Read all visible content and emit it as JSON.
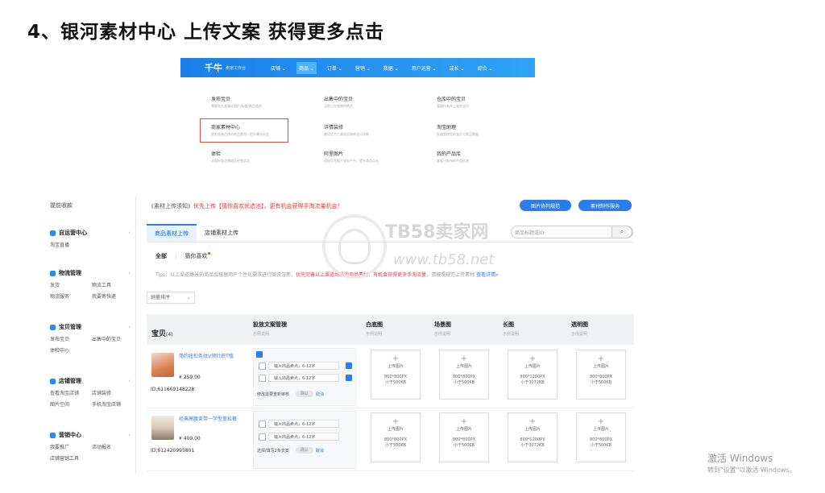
{
  "slide_title": "4、银河素材中心 上传文案 获得更多点击",
  "topnav": {
    "logo": "千牛",
    "logo_sub": "卖家工作台",
    "items": [
      "店铺 ⌄",
      "商品 ⌄",
      "订单 ⌄",
      "营销 ⌄",
      "数据 ⌄",
      "用户运营 ⌄",
      "成长 ⌄",
      "综合 ⌄"
    ]
  },
  "menu": [
    {
      "title": "发布宝贝",
      "desc": "需要帮先准备好图片/标题/商品描述"
    },
    {
      "title": "出售中的宝贝",
      "desc": "当前正在销售的商品"
    },
    {
      "title": "仓库中的宝贝",
      "desc": "管理所有未上架的宝贝"
    },
    {
      "title": "商家素材中心",
      "desc": "提前准备优质的商品素材，提升曝光机会"
    },
    {
      "title": "详情装修",
      "desc": "使用官方工具轻松装修宝贝详情"
    },
    {
      "title": "淘宝助理",
      "desc": "批量管理您的宝贝与商品数据"
    },
    {
      "title": "体检",
      "desc": "全面检查店铺商品经营状况"
    },
    {
      "title": "阿里图片",
      "desc": "阿里官方图片服务平台，提升商品点击"
    },
    {
      "title": "我的产品库",
      "desc": "查看已发布的产品信息"
    }
  ],
  "sidebar": {
    "top": "提前收款",
    "groups": [
      {
        "title": "自运营中心",
        "links": [
          "淘宝直播"
        ]
      },
      {
        "title": "物流管理",
        "links": [
          "发货",
          "物流工具",
          "物流服务",
          "我要寄快递"
        ]
      },
      {
        "title": "宝贝管理",
        "links": [
          "发布宝贝",
          "出售中的宝贝",
          "体检中心"
        ]
      },
      {
        "title": "店铺管理",
        "links": [
          "查看淘宝店铺",
          "店铺装修",
          "图片空间",
          "手机淘宝店铺"
        ]
      },
      {
        "title": "营销中心",
        "links": [
          "我要推广",
          "活动报名",
          "店铺营销工具"
        ]
      }
    ]
  },
  "notice": {
    "part1": "《素材上传须知》",
    "part2": "优先上传【猜你喜欢优选池】，更有机会获得手淘流量机会！"
  },
  "buttons": {
    "spec": "图片协判规范",
    "service": "素材制作服务"
  },
  "tabs": [
    "商品素材上传",
    "店铺素材上传"
  ],
  "search": {
    "placeholder": "商品标题或ID",
    "icon": "search-icon"
  },
  "subtabs": [
    "全部",
    "猜你喜欢"
  ],
  "tips": {
    "prefix": "Tips：以上渠道场景的商品会根据用户个性化需求进行图说渲新，",
    "red1": "优先完善以上渠道场景的商品素材",
    "mid": "，",
    "red2": "有机会获得更多手淘流量",
    "suffix": "，请按照规范上传素材 ",
    "link": "查看详情»"
  },
  "sort": "销量排序",
  "table": {
    "headers": [
      {
        "title": "宝贝",
        "sub": "",
        "count": "(4)"
      },
      {
        "title": "投放文案管理",
        "sub": "示例说明"
      },
      {
        "title": "白底图",
        "sub": "示例说明"
      },
      {
        "title": "场景图",
        "sub": "示例说明"
      },
      {
        "title": "长图",
        "sub": "示例说明"
      },
      {
        "title": "透明图",
        "sub": "示例说明"
      }
    ],
    "rows": [
      {
        "title": "简约纽扣条纹V领针织T恤",
        "price": "¥ 259.00",
        "id": "ID:611669148228",
        "copy_lines": [
          "输入商品卖点，6-12字",
          "输入商品卖点，6-12字"
        ],
        "foot": "修改需要重新审核",
        "ok": "确认",
        "cancel": "取消",
        "cells": [
          {
            "u": "上传图片",
            "size": "800*800PX",
            "limit": "小于500KB"
          },
          {
            "u": "上传图片",
            "size": "800*800PX",
            "limit": "小于500KB"
          },
          {
            "u": "上传图片",
            "size": "800*1200PX",
            "limit": "小于3072KB"
          },
          {
            "u": "上传图片",
            "size": "800*800PX",
            "limit": "小于500KB"
          }
        ]
      },
      {
        "title": "经典高腰束带一字型宽松裤",
        "price": "¥ 409.00",
        "id": "ID:612420995801",
        "copy_lines": [
          "输入商品卖点，6-12字",
          "输入商品卖点，6-12字"
        ],
        "foot": "选择/填写2条文案",
        "ok": "确认",
        "cancel": "取消",
        "cells": [
          {
            "u": "上传图片",
            "size": "800*800PX",
            "limit": "小于500KB"
          },
          {
            "u": "上传图片",
            "size": "800*800PX",
            "limit": "小于500KB"
          },
          {
            "u": "上传图片",
            "size": "800*1200PX",
            "limit": "小于3072KB"
          },
          {
            "u": "上传图片",
            "size": "800*800PX",
            "limit": "小于500KB"
          }
        ]
      }
    ]
  },
  "watermark": {
    "t1": "TB58卖家网",
    "t2": "www.tb58.net"
  },
  "windows": {
    "line1": "激活 Windows",
    "line2": "转到\"设置\"以激活 Windows。"
  },
  "colors": {
    "accent": "#2b7de9",
    "alert": "#e0393e",
    "highlight_box": "#e04b3f"
  }
}
